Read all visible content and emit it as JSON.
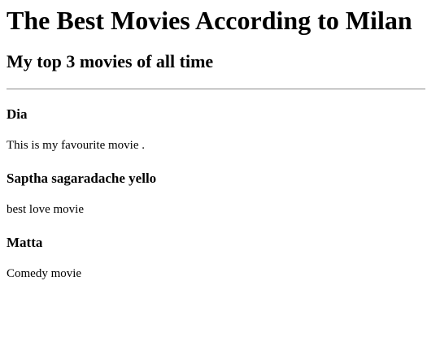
{
  "page": {
    "title": "The Best Movies According to Milan",
    "subtitle": "My top 3 movies of all time"
  },
  "movies": [
    {
      "title": "Dia",
      "description": "This is my favourite movie ."
    },
    {
      "title": "Saptha sagaradache yello",
      "description": "best love movie"
    },
    {
      "title": "Matta",
      "description": "Comedy movie"
    }
  ]
}
